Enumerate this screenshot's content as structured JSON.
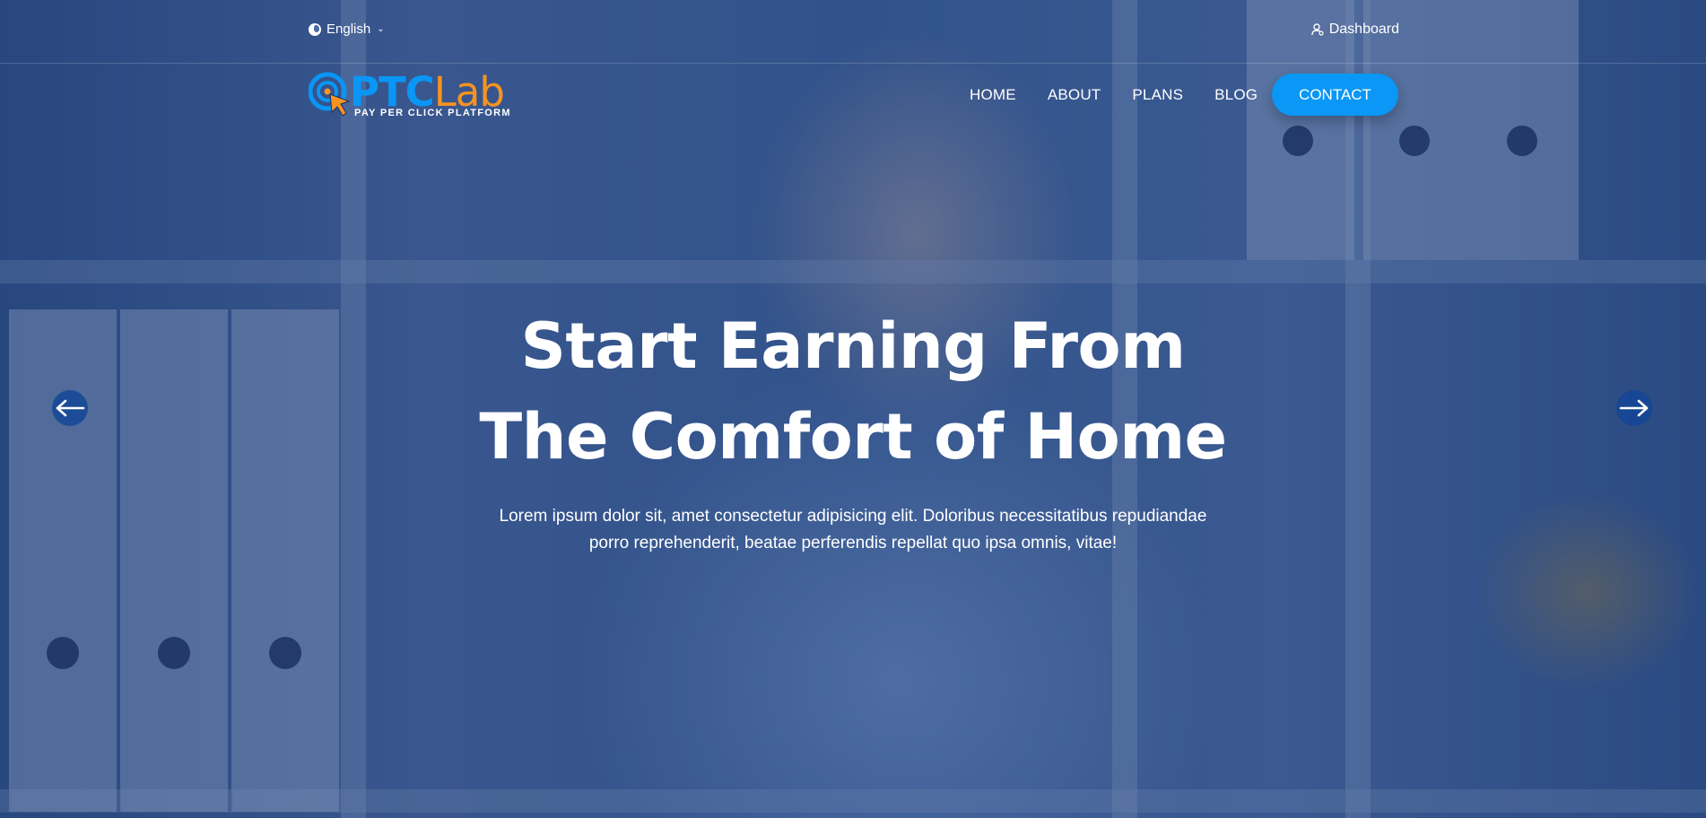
{
  "topbar": {
    "language": "English",
    "dashboard": "Dashboard"
  },
  "logo": {
    "part1": "PTC",
    "part2": "Lab",
    "tagline": "PAY PER CLICK PLATFORM"
  },
  "nav": {
    "items": [
      "HOME",
      "ABOUT",
      "PLANS",
      "BLOG"
    ],
    "contact": "CONTACT"
  },
  "hero": {
    "title_line1": "Start Earning From",
    "title_line2": "The Comfort of Home",
    "description": "Lorem ipsum dolor sit, amet consectetur adipisicing elit. Doloribus necessitatibus repudiandae porro reprehenderit, beatae perferendis repellat quo ipsa omnis, vitae!"
  },
  "colors": {
    "accent": "#0a97f5",
    "logo_orange": "#f7931e",
    "overlay": "#12306e"
  },
  "icons": {
    "language": "globe-icon",
    "dashboard": "user-icon",
    "prev": "arrow-left-icon",
    "next": "arrow-right-icon"
  }
}
